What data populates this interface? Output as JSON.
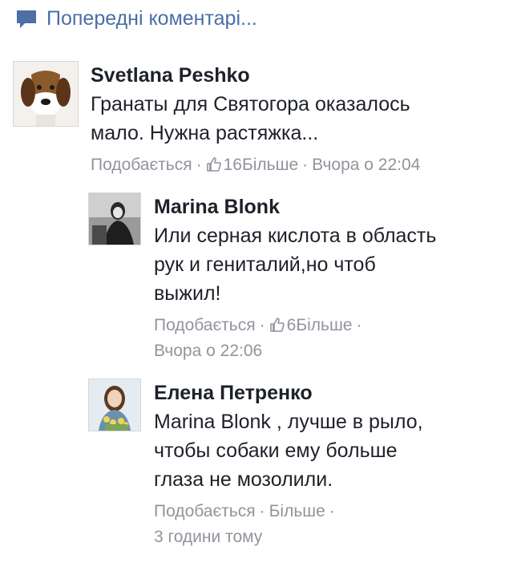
{
  "previous_comments_label": "Попередні коментарі...",
  "comments": [
    {
      "author": "Svetlana Peshko",
      "text_lines": [
        "Гранаты для Святогора оказалось",
        "мало. Нужна растяжка..."
      ],
      "like_label": "Подобається",
      "like_count": "16",
      "more_label": "Більше",
      "time": "Вчора о 22:04"
    },
    {
      "author": "Marina Blonk",
      "text_lines": [
        "Или серная кислота в область",
        "рук и гениталий,но чтоб",
        "выжил!"
      ],
      "like_label": "Подобається",
      "like_count": "6",
      "more_label": "Більше",
      "time": "Вчора о 22:06"
    },
    {
      "author": "Елена Петренко",
      "text_lines": [
        "Marina Blonk , лучше в рыло,",
        "чтобы собаки ему больше",
        "глаза не мозолили."
      ],
      "like_label": "Подобається",
      "more_label": "Більше",
      "time": "3 години тому"
    }
  ],
  "colors": {
    "link": "#4b6fa6",
    "meta": "#90949c",
    "text": "#1d2129"
  },
  "icons": {
    "previous": "speech-bubble-icon",
    "like": "thumbs-up-icon"
  }
}
